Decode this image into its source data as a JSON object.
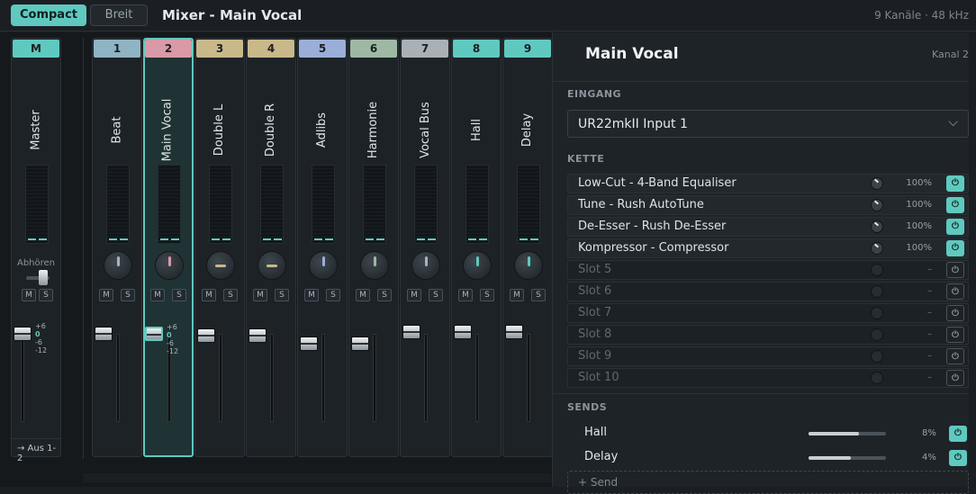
{
  "topbar": {
    "compact_label": "Compact",
    "wide_label": "Breit",
    "title": "Mixer - Main Vocal",
    "meta": "9 Kanäle · 48 kHz"
  },
  "master": {
    "num": "M",
    "name": "Master",
    "monitor_label": "Abhören",
    "mute": "M",
    "solo": "S",
    "output": "→ Aus 1-2",
    "scale": [
      "+6",
      "0",
      "-6",
      "-12"
    ],
    "color": "#5fc9bf",
    "knob_color": "#aab3ba"
  },
  "channels": [
    {
      "num": "1",
      "name": "Beat",
      "color": "#8fb4c4",
      "knob_color": "#aab3ba",
      "mute": "M",
      "solo": "S"
    },
    {
      "num": "2",
      "name": "Main Vocal",
      "color": "#d89aa6",
      "knob_color": "#d89aa6",
      "mute": "M",
      "solo": "S",
      "selected": true,
      "scale": [
        "+6",
        "0",
        "-6",
        "-12"
      ]
    },
    {
      "num": "3",
      "name": "Double L",
      "color": "#c9b88a",
      "knob_color": "#c9b88a",
      "mute": "M",
      "solo": "S"
    },
    {
      "num": "4",
      "name": "Double R",
      "color": "#c9b88a",
      "knob_color": "#c9b88a",
      "mute": "M",
      "solo": "S"
    },
    {
      "num": "5",
      "name": "Adlibs",
      "color": "#9aaed8",
      "knob_color": "#9aaed8",
      "mute": "M",
      "solo": "S"
    },
    {
      "num": "6",
      "name": "Harmonie",
      "color": "#9eb8a4",
      "knob_color": "#9eb8a4",
      "mute": "M",
      "solo": "S"
    },
    {
      "num": "7",
      "name": "Vocal Bus",
      "color": "#a9b0b6",
      "knob_color": "#a9b0b6",
      "mute": "M",
      "solo": "S"
    },
    {
      "num": "8",
      "name": "Hall",
      "color": "#5fc9bf",
      "knob_color": "#5fc9bf",
      "mute": "M",
      "solo": "S"
    },
    {
      "num": "9",
      "name": "Delay",
      "color": "#5fc9bf",
      "knob_color": "#5fc9bf",
      "mute": "M",
      "solo": "S"
    }
  ],
  "panel": {
    "title": "Main Vocal",
    "channel": "Kanal 2",
    "input_section": "EINGANG",
    "input_value": "UR22mkII Input 1",
    "chain_section": "KETTE",
    "chain": [
      {
        "label": "Low-Cut - 4-Band Equaliser",
        "amount": "100%",
        "power": "⏻",
        "active": true
      },
      {
        "label": "Tune - Rush AutoTune",
        "amount": "100%",
        "power": "⏻",
        "active": true
      },
      {
        "label": "De-Esser - Rush De-Esser",
        "amount": "100%",
        "power": "⏻",
        "active": true
      },
      {
        "label": "Kompressor - Compressor",
        "amount": "100%",
        "power": "⏻",
        "active": true
      },
      {
        "label": "Slot 5",
        "amount": "–",
        "power": "⏻",
        "active": false
      },
      {
        "label": "Slot 6",
        "amount": "–",
        "power": "⏻",
        "active": false
      },
      {
        "label": "Slot 7",
        "amount": "–",
        "power": "⏻",
        "active": false
      },
      {
        "label": "Slot 8",
        "amount": "–",
        "power": "⏻",
        "active": false
      },
      {
        "label": "Slot 9",
        "amount": "–",
        "power": "⏻",
        "active": false
      },
      {
        "label": "Slot 10",
        "amount": "–",
        "power": "⏻",
        "active": false
      }
    ],
    "sends_section": "SENDS",
    "sends": [
      {
        "label": "Hall",
        "value": "8%",
        "power": "⏻",
        "level": 0.65
      },
      {
        "label": "Delay",
        "value": "4%",
        "power": "⏻",
        "level": 0.55
      }
    ],
    "add_send": "+ Send"
  },
  "colors": {
    "accent": "#5fc9bf",
    "background": "#1b1f23"
  }
}
